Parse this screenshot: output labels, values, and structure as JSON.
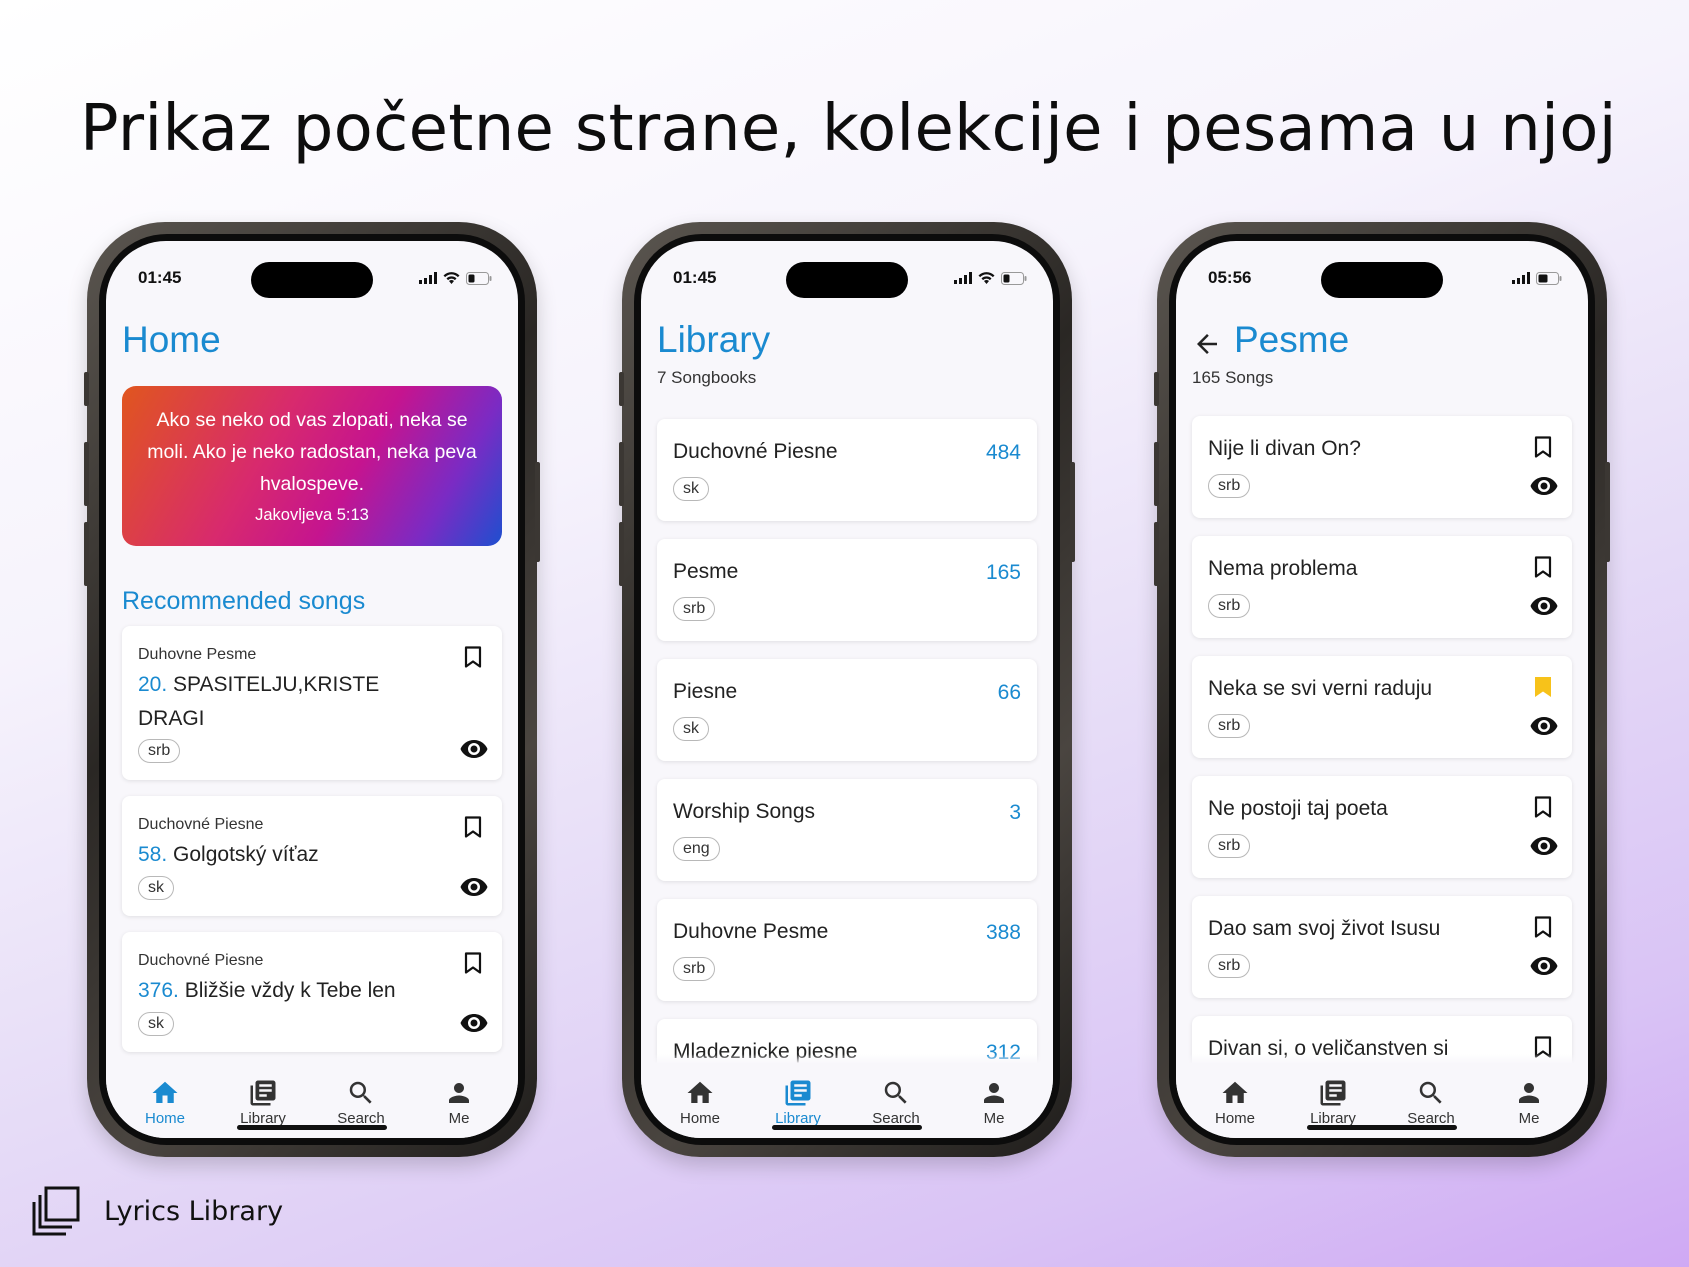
{
  "headline": "Prikaz početne strane, kolekcije i pesama u njoj",
  "brand": {
    "name": "Lyrics Library"
  },
  "colors": {
    "accent": "#1a8ad0",
    "bookmark_active": "#f7c21a"
  },
  "tabs": [
    "Home",
    "Library",
    "Search",
    "Me"
  ],
  "phones": {
    "home": {
      "time": "01:45",
      "title": "Home",
      "verse": {
        "text": "Ako se neko od vas zlopati, neka se moli. Ako je neko radostan, neka peva hvalospeve.",
        "reference": "Jakovljeva 5:13"
      },
      "section_title": "Recommended songs",
      "songs": [
        {
          "book": "Duhovne Pesme",
          "number": "20.",
          "title": "SPASITELJU,KRISTE DRAGI",
          "lang": "srb"
        },
        {
          "book": "Duchovné Piesne",
          "number": "58.",
          "title": "Golgotský víťaz",
          "lang": "sk"
        },
        {
          "book": "Duchovné Piesne",
          "number": "376.",
          "title": "Bližšie vždy k Tebe len",
          "lang": "sk"
        }
      ],
      "active_tab": "Home"
    },
    "library": {
      "time": "01:45",
      "title": "Library",
      "subtitle": "7 Songbooks",
      "books": [
        {
          "name": "Duchovné Piesne",
          "count": "484",
          "lang": "sk"
        },
        {
          "name": "Pesme",
          "count": "165",
          "lang": "srb"
        },
        {
          "name": "Piesne",
          "count": "66",
          "lang": "sk"
        },
        {
          "name": "Worship Songs",
          "count": "3",
          "lang": "eng"
        },
        {
          "name": "Duhovne Pesme",
          "count": "388",
          "lang": "srb"
        },
        {
          "name": "Mladeznicke piesne",
          "count": "312",
          "lang": ""
        }
      ],
      "active_tab": "Library"
    },
    "pesme": {
      "time": "05:56",
      "title": "Pesme",
      "subtitle": "165 Songs",
      "songs": [
        {
          "title": "Nije li divan On?",
          "lang": "srb",
          "bookmarked": false
        },
        {
          "title": "Nema problema",
          "lang": "srb",
          "bookmarked": false
        },
        {
          "title": "Neka se svi verni raduju",
          "lang": "srb",
          "bookmarked": true
        },
        {
          "title": "Ne postoji taj poeta",
          "lang": "srb",
          "bookmarked": false
        },
        {
          "title": "Dao sam svoj život Isusu",
          "lang": "srb",
          "bookmarked": false
        },
        {
          "title": "Divan si, o veličanstven si",
          "lang": "",
          "bookmarked": false
        }
      ],
      "active_tab": null
    }
  }
}
